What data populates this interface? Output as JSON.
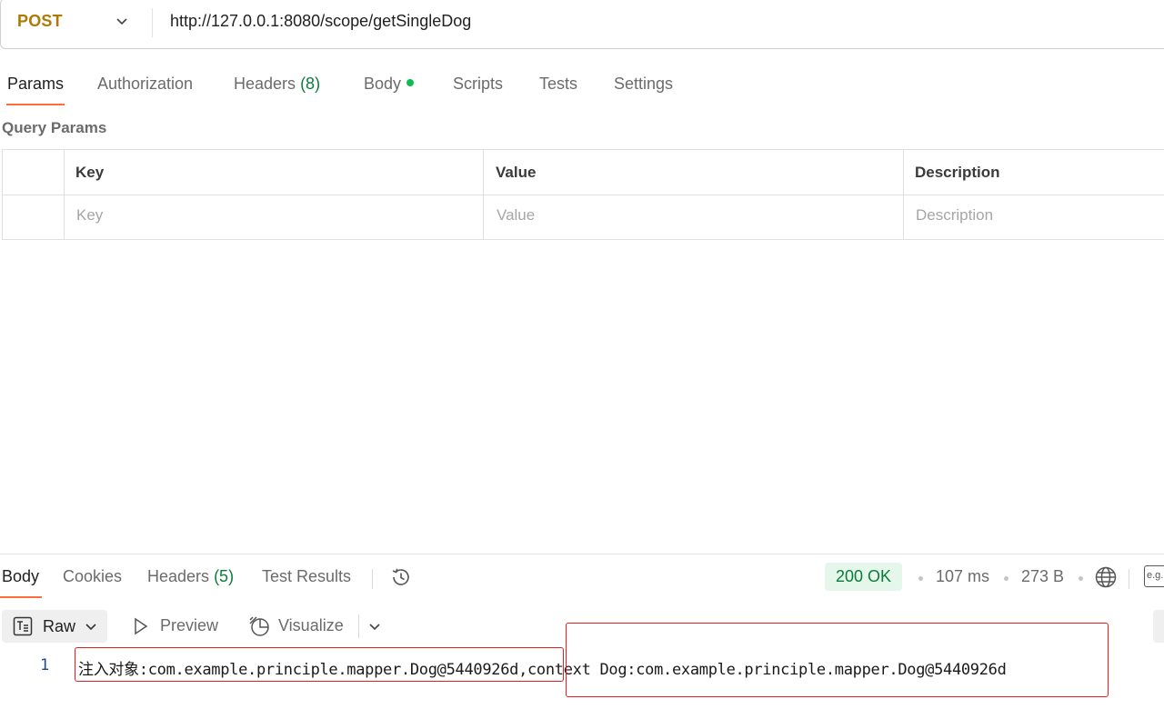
{
  "request": {
    "method": "POST",
    "url": "http://127.0.0.1:8080/scope/getSingleDog"
  },
  "request_tabs": {
    "params": "Params",
    "authorization": "Authorization",
    "headers": "Headers",
    "headers_count": "(8)",
    "body": "Body",
    "scripts": "Scripts",
    "tests": "Tests",
    "settings": "Settings"
  },
  "query_params": {
    "title": "Query Params",
    "columns": [
      "Key",
      "Value",
      "Description"
    ],
    "placeholders": [
      "Key",
      "Value",
      "Description"
    ]
  },
  "response_tabs": {
    "body": "Body",
    "cookies": "Cookies",
    "headers": "Headers",
    "headers_count": "(5)",
    "test_results": "Test Results"
  },
  "response_meta": {
    "status": "200 OK",
    "time": "107 ms",
    "size": "273 B",
    "eg_label": "e.g."
  },
  "response_toolbar": {
    "format": "Raw",
    "preview": "Preview",
    "visualize": "Visualize"
  },
  "response_body": {
    "line_number": "1",
    "content": "注入对象:com.example.principle.mapper.Dog@5440926d,context Dog:com.example.principle.mapper.Dog@5440926d"
  },
  "colors": {
    "method": "#ad7a03",
    "accent": "#ff6c37",
    "success": "#0c7c3a",
    "highlight_box": "#e02020"
  }
}
